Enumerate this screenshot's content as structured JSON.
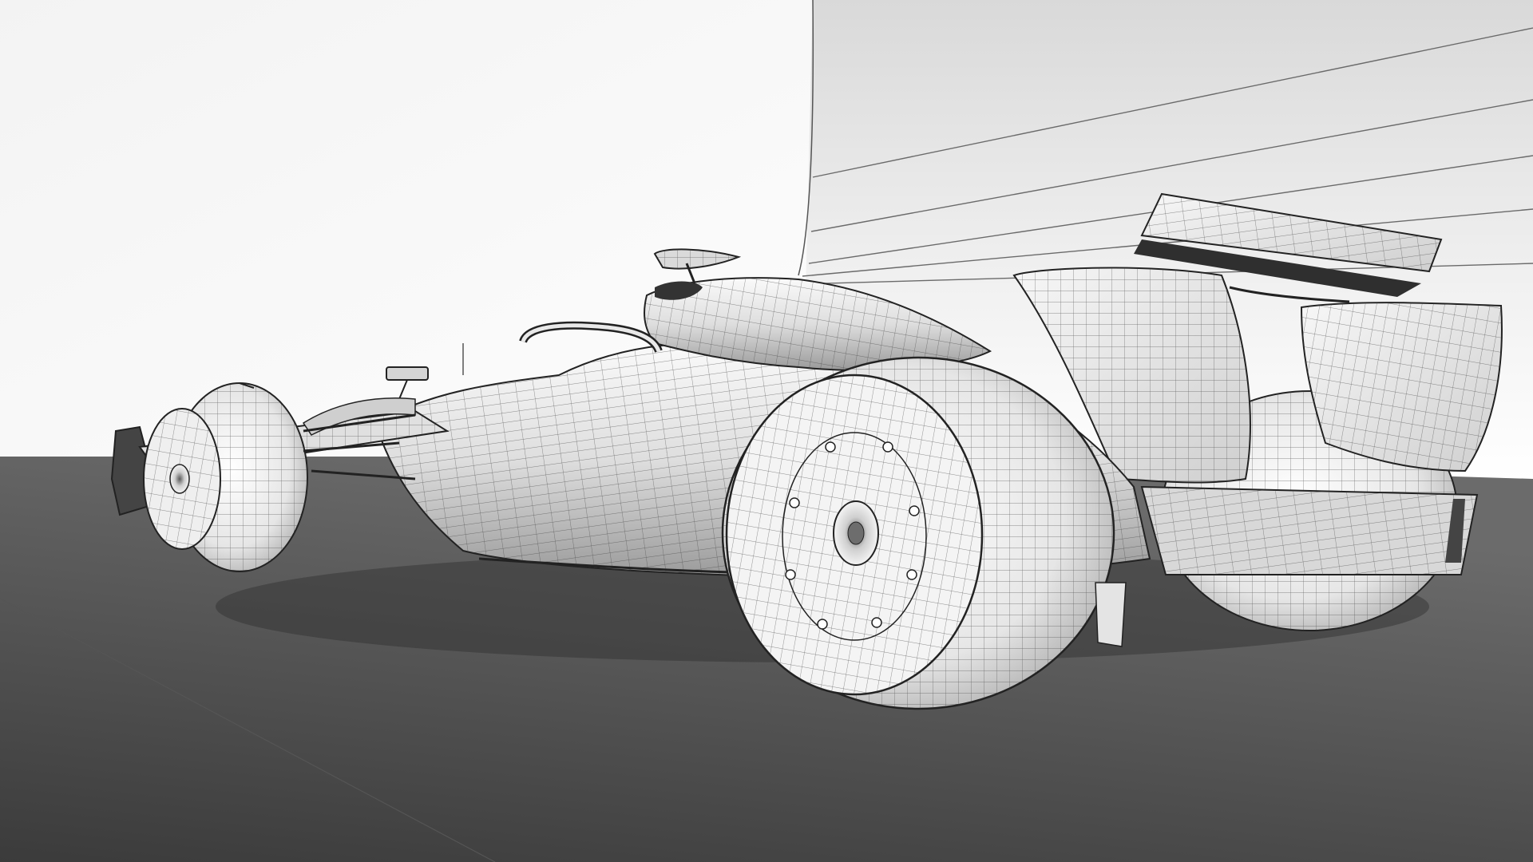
{
  "scene": {
    "style": "wireframe-render",
    "subject": "formula-one-car",
    "colors": {
      "sky_top": "#f2f2f2",
      "sky_bottom": "#ffffff",
      "wall_top": "#dcdcdc",
      "wall_bottom": "#ffffff",
      "floor_near": "#3f3f3f",
      "floor_far": "#6a6a6a",
      "surface_light": "#f5f5f5",
      "surface_mid": "#cfcfcf",
      "surface_dark": "#8c8c8c",
      "tire": "#e8e8e8",
      "line": "#2a2a2a",
      "mesh": "#4a4a4a"
    }
  }
}
